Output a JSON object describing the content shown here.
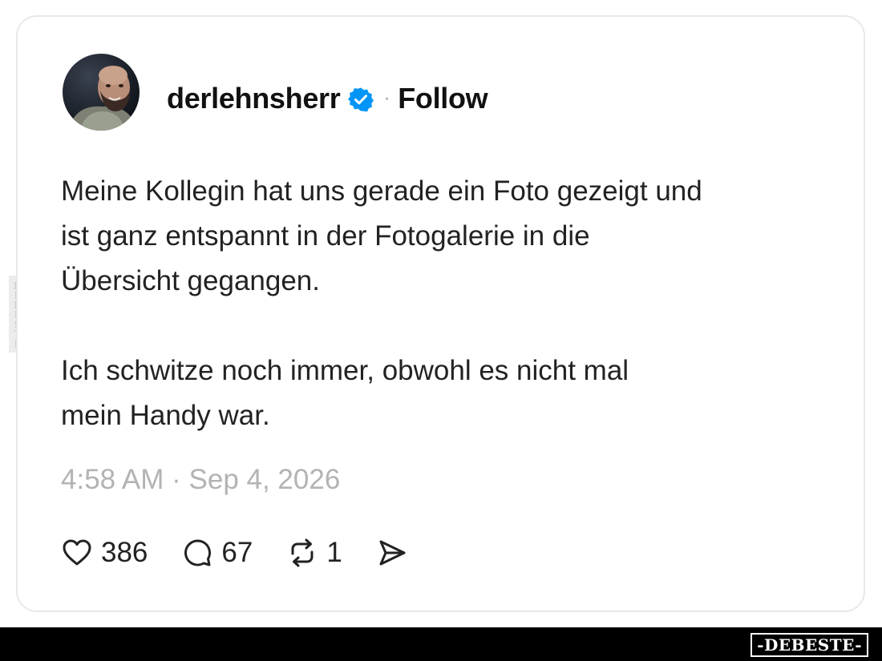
{
  "post": {
    "username": "derlehnsherr",
    "separator": "·",
    "follow_label": "Follow",
    "text": "Meine Kollegin hat uns gerade ein Foto gezeigt und\nist ganz entspannt in der Fotogalerie in die\nÜbersicht gegangen.\n\nIch schwitze noch immer, obwohl es nicht mal\nmein Handy war.",
    "timestamp": "4:58 AM · Sep 4, 2026"
  },
  "actions": {
    "likes": {
      "icon": "heart-icon",
      "count": "386"
    },
    "replies": {
      "icon": "comment-icon",
      "count": "67"
    },
    "reposts": {
      "icon": "repost-icon",
      "count": "1"
    },
    "share": {
      "icon": "send-icon"
    }
  },
  "watermark": {
    "side": "DEBESTE",
    "brand": "-DEBESTE-"
  },
  "colors": {
    "verified": "#0095f6",
    "timestamp": "#b3b3b3",
    "card_border": "#e8e8e8",
    "footer": "#000000"
  }
}
